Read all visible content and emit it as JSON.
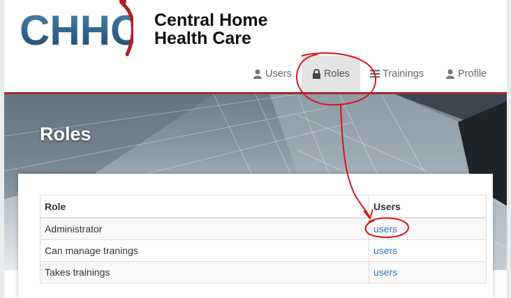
{
  "brand": {
    "logo_letters": "CHHC",
    "name_line1": "Central Home",
    "name_line2": "Health Care",
    "colors": {
      "logo_blue": "#2e5f86",
      "logo_red": "#b21e28",
      "accent_rule": "#a52a2a",
      "link": "#337ab7"
    }
  },
  "nav": {
    "items": [
      {
        "label": "Users",
        "icon": "user-icon"
      },
      {
        "label": "Roles",
        "icon": "lock-icon",
        "active": true
      },
      {
        "label": "Trainings",
        "icon": "list-icon"
      },
      {
        "label": "Profile",
        "icon": "user-icon"
      }
    ]
  },
  "hero": {
    "title": "Roles"
  },
  "table": {
    "headers": [
      "Role",
      "Users"
    ],
    "rows": [
      {
        "role": "Administrator",
        "users_link": "users"
      },
      {
        "role": "Can manage tranings",
        "users_link": "users"
      },
      {
        "role": "Takes trainings",
        "users_link": "users"
      }
    ]
  }
}
